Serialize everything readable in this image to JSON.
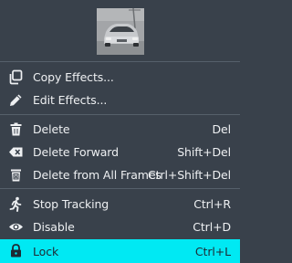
{
  "menu": {
    "items": [
      {
        "label": "Copy Effects...",
        "shortcut": "",
        "icon": "copy-icon"
      },
      {
        "label": "Edit Effects...",
        "shortcut": "",
        "icon": "pencil-icon"
      },
      {
        "label": "Delete",
        "shortcut": "Del",
        "icon": "trash-icon"
      },
      {
        "label": "Delete Forward",
        "shortcut": "Shift+Del",
        "icon": "backspace-x-icon"
      },
      {
        "label": "Delete from All Frames",
        "shortcut": "Ctrl+Shift+Del",
        "icon": "trash-frames-icon"
      },
      {
        "label": "Stop Tracking",
        "shortcut": "Ctrl+R",
        "icon": "running-figure-icon"
      },
      {
        "label": "Disable",
        "shortcut": "Ctrl+D",
        "icon": "eye-icon"
      },
      {
        "label": "Lock",
        "shortcut": "Ctrl+L",
        "icon": "lock-icon"
      }
    ],
    "highlighted_item": "Lock"
  },
  "colors": {
    "background": "#39414b",
    "highlight": "#00e9f3",
    "text": "#eef0f2"
  }
}
